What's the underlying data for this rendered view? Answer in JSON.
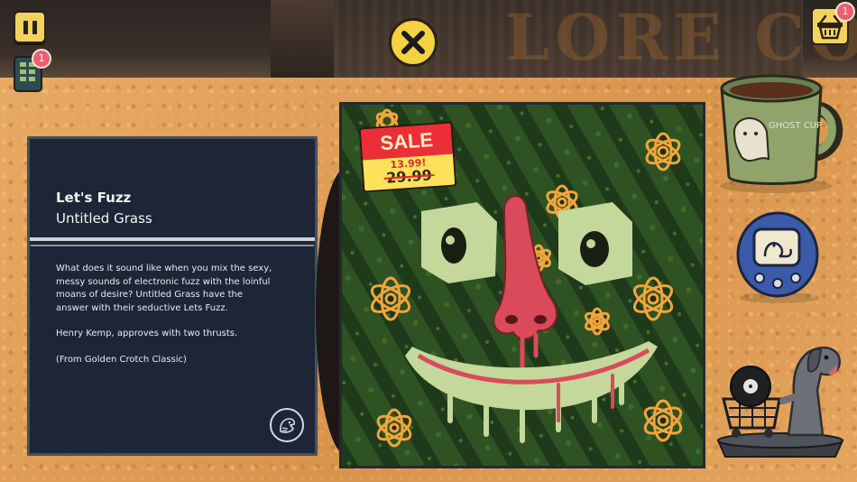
{
  "hud": {
    "pause_icon": "pause-icon",
    "phone_icon": "phone-grid-icon",
    "phone_badge": "1",
    "close_icon": "close-x-icon",
    "cart_icon": "shopping-basket-icon",
    "cart_badge": "1"
  },
  "store_sign": "LORE CO",
  "album": {
    "title": "Let's Fuzz",
    "artist": "Untitled Grass",
    "description": [
      "What does it sound like when you mix the sexy, messy sounds of electronic fuzz with the loinful moans of desire? Untitled Grass have the answer with their seductive Lets Fuzz.",
      "Henry Kemp, approves with two thrusts.",
      "(From Golden Crotch Classic)"
    ],
    "label_icon": "record-label-bird-icon"
  },
  "sale_tag": {
    "label": "SALE",
    "price_new": "13.99!",
    "price_old": "29.99"
  },
  "mug_text": "GHOST CUP",
  "colors": {
    "panel_bg": "#1d2637",
    "accent_yellow": "#f4d240",
    "badge_red": "#ef5d6e",
    "sale_red": "#ec2f36",
    "cork": "#e6a55c"
  }
}
